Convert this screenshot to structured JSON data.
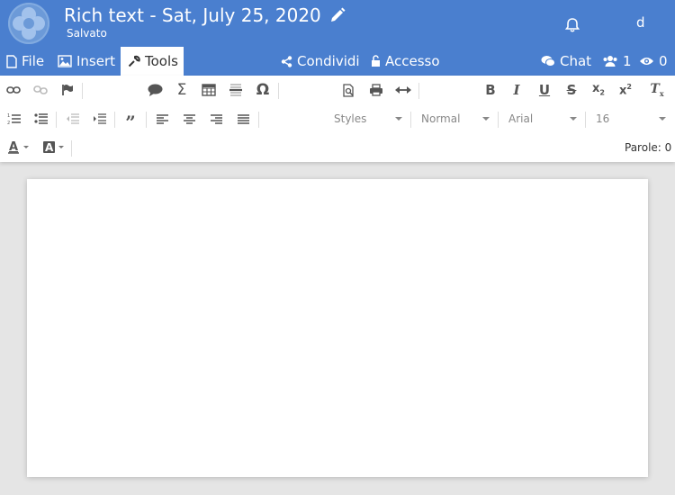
{
  "header": {
    "title": "Rich text - Sat, July 25, 2020",
    "status": "Salvato",
    "user_initial": "d"
  },
  "menu": {
    "file": "File",
    "insert": "Insert",
    "tools": "Tools",
    "share": "Condividi",
    "access": "Accesso",
    "chat": "Chat",
    "users_count": "1",
    "viewers_count": "0"
  },
  "toolbar": {
    "style_select": "Styles",
    "format_select": "Normal",
    "font_select": "Arial",
    "size_select": "16",
    "word_count": "Parole: 0"
  },
  "colors": {
    "brand": "#4a7fcf",
    "toolbar_bg": "#ffffff",
    "page_bg": "#e5e5e5"
  }
}
